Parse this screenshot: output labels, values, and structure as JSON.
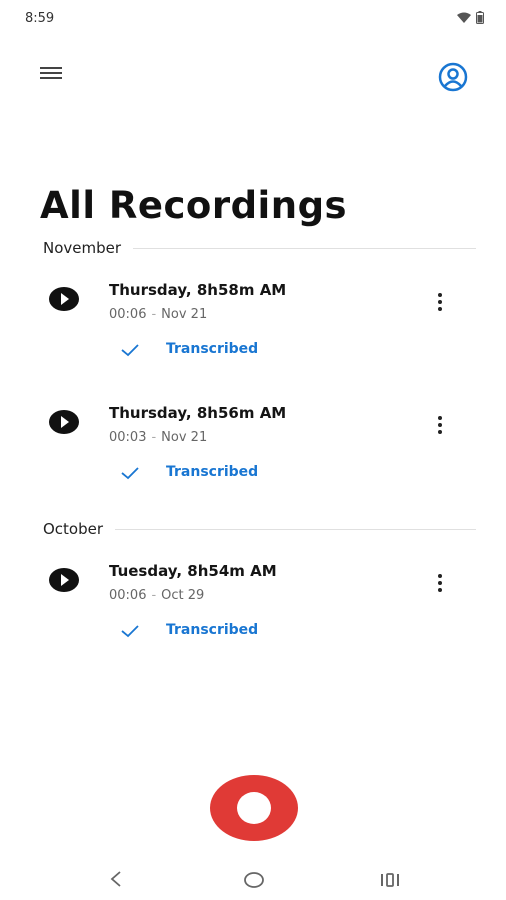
{
  "status_bar": {
    "time": "8:59"
  },
  "page": {
    "title": "All Recordings"
  },
  "sections": [
    {
      "label": "November",
      "recordings": [
        {
          "title": "Thursday, 8h58m AM",
          "duration": "00:06",
          "date": "Nov 21",
          "status": "Transcribed"
        },
        {
          "title": "Thursday, 8h56m AM",
          "duration": "00:03",
          "date": "Nov 21",
          "status": "Transcribed"
        }
      ]
    },
    {
      "label": "October",
      "recordings": [
        {
          "title": "Tuesday, 8h54m AM",
          "duration": "00:06",
          "date": "Oct 29",
          "status": "Transcribed"
        }
      ]
    }
  ],
  "colors": {
    "accent": "#1976d2",
    "record": "#e03a36",
    "text": "#111111"
  },
  "icons": {
    "menu": "hamburger-icon",
    "account": "account-circle-icon",
    "play": "play-icon",
    "more": "more-vertical-icon",
    "check": "check-icon",
    "record": "record-icon",
    "nav_back": "back-icon",
    "nav_home": "home-icon",
    "nav_recents": "recents-icon"
  }
}
